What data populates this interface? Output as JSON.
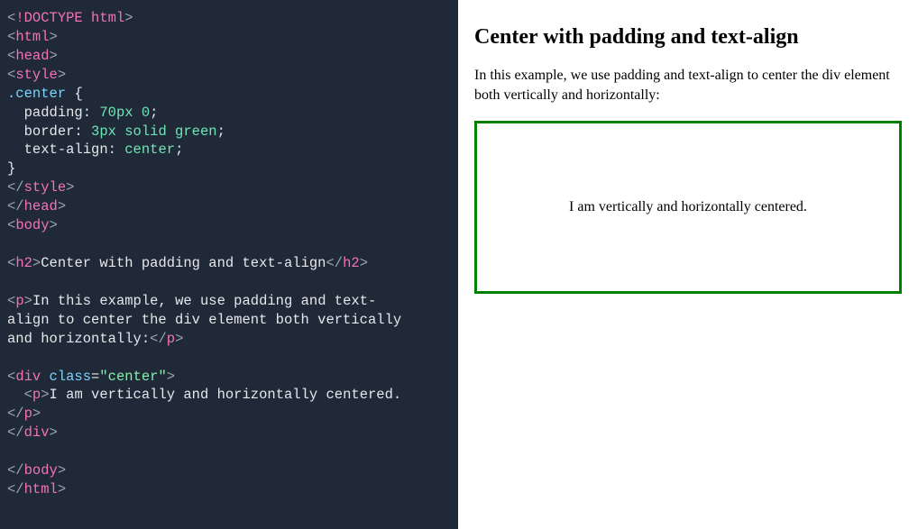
{
  "code": {
    "doctype": "<!DOCTYPE html>",
    "tag_html_open": "html",
    "tag_head_open": "head",
    "tag_style_open": "style",
    "selector": ".center",
    "brace_open": "{",
    "prop1_name": "padding",
    "prop1_value": "70px 0",
    "prop2_name": "border",
    "prop2_value": "3px solid green",
    "prop3_name": "text-align",
    "prop3_value": "center",
    "brace_close": "}",
    "tag_style_close": "style",
    "tag_head_close": "head",
    "tag_body_open": "body",
    "tag_h2_open": "h2",
    "h2_text": "Center with padding and text-align",
    "tag_h2_close": "h2",
    "tag_p_open": "p",
    "p1_text_a": "In this example, we use padding and text-",
    "p1_text_b": "align to center the div element both vertically ",
    "p1_text_c": "and horizontally:",
    "tag_p_close": "p",
    "tag_div_open": "div",
    "attr_class": "class",
    "attr_class_val": "\"center\"",
    "p2_text": "I am vertically and horizontally centered.",
    "tag_div_close": "div",
    "tag_body_close": "body",
    "tag_html_close": "html"
  },
  "preview": {
    "heading": "Center with padding and text-align",
    "intro": "In this example, we use padding and text-align to center the div element both vertically and horizontally:",
    "box_text": "I am vertically and horizontally centered."
  }
}
